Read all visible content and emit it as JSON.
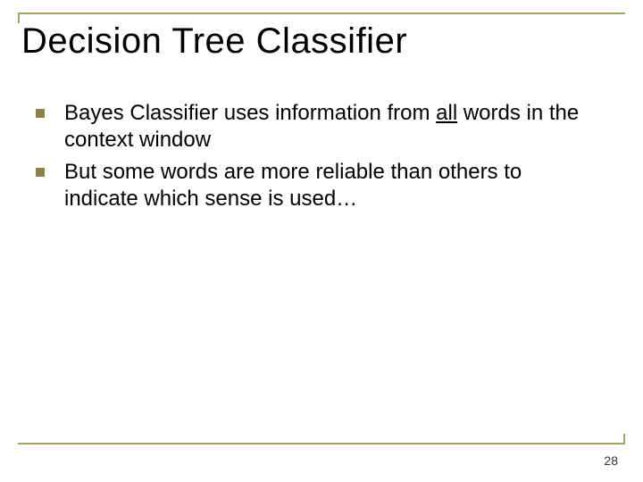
{
  "title": "Decision Tree Classifier",
  "bullets": [
    {
      "pre": "Bayes Classifier uses information from ",
      "underlined": "all",
      "post": " words in the context window"
    },
    {
      "pre": "But some words are more reliable than others to indicate which sense is used…",
      "underlined": "",
      "post": ""
    }
  ],
  "page_number": "28"
}
